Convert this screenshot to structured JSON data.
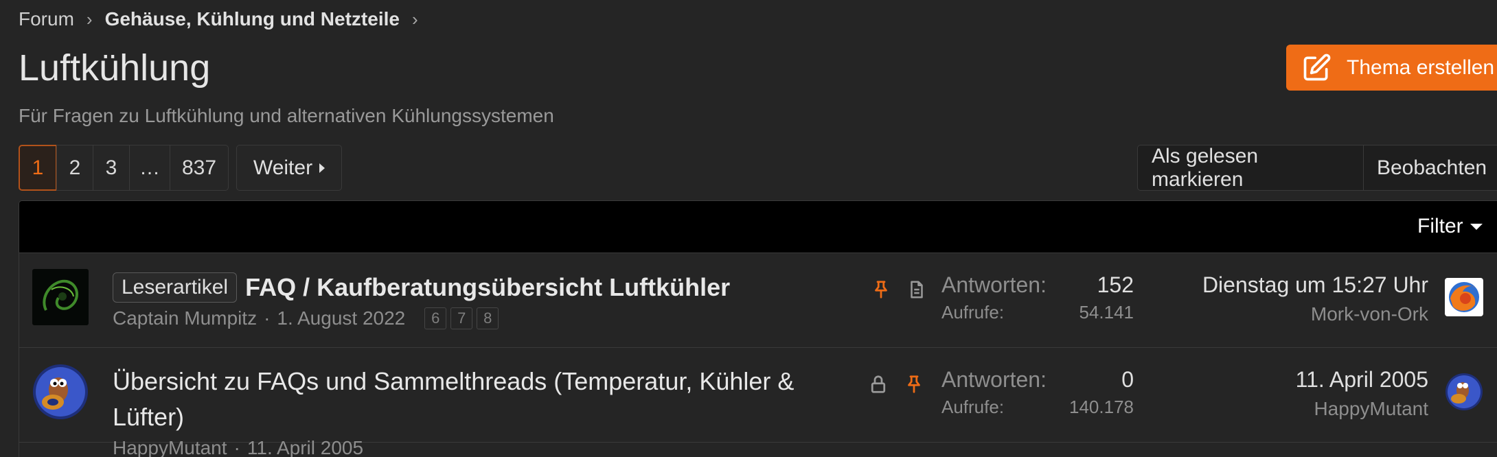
{
  "breadcrumb": {
    "items": [
      "Forum",
      "Gehäuse, Kühlung und Netzteile"
    ]
  },
  "page": {
    "title": "Luftkühlung",
    "description": "Für Fragen zu Luftkühlung und alternativen Kühlungssystemen"
  },
  "create_button": {
    "label": "Thema erstellen",
    "color": "#ef6c16"
  },
  "pagination": {
    "pages": [
      "1",
      "2",
      "3",
      "…",
      "837"
    ],
    "current": "1",
    "next_label": "Weiter"
  },
  "actions": {
    "mark_read": "Als gelesen markieren",
    "watch": "Beobachten"
  },
  "filter": {
    "label": "Filter"
  },
  "threads": [
    {
      "prefix": "Leserartikel",
      "title": "FAQ / Kaufberatungsübersicht Luftkühler",
      "author": "Captain Mumpitz",
      "date": "1. August 2022",
      "meta_sep": "·",
      "mini_pages": [
        "6",
        "7",
        "8"
      ],
      "icons": [
        "pin-icon",
        "document-icon"
      ],
      "replies_label": "Antworten:",
      "replies": "152",
      "views_label": "Aufrufe:",
      "views": "54.141",
      "last_date": "Dienstag um 15:27 Uhr",
      "last_user": "Mork-von-Ork"
    },
    {
      "title_line1": "Übersicht zu FAQs und Sammelthreads (Temperatur, Kühler &",
      "title_line2": "Lüfter)",
      "author": "HappyMutant",
      "date": "11. April 2005",
      "meta_sep": "·",
      "icons": [
        "lock-icon",
        "pin-icon"
      ],
      "replies_label": "Antworten:",
      "replies": "0",
      "views_label": "Aufrufe:",
      "views": "140.178",
      "last_date": "11. April 2005",
      "last_user": "HappyMutant"
    }
  ],
  "colors": {
    "accent": "#ef6c16",
    "background": "#252525",
    "filter_bar": "#000000"
  }
}
